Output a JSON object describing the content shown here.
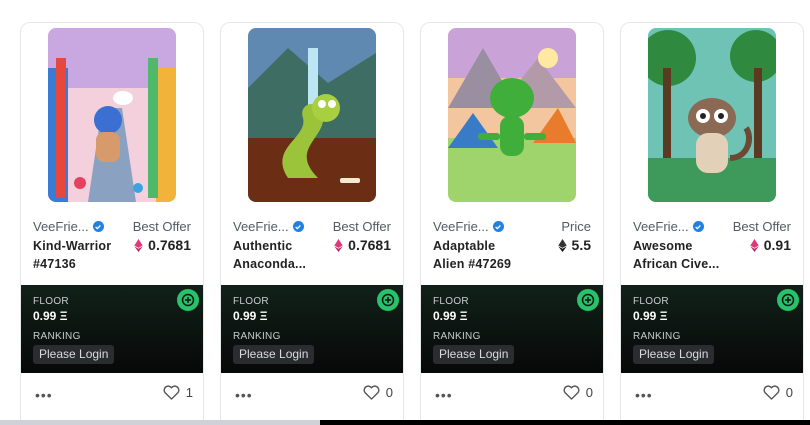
{
  "cards": [
    {
      "collection": "VeeFrie...",
      "offer_label": "Best Offer",
      "name": "Kind-Warrior #47136",
      "price": "0.7681",
      "price_icon": "eth-pink-icon",
      "floor_label": "FLOOR",
      "floor_value": "0.99 Ξ",
      "ranking_label": "RANKING",
      "login_label": "Please Login",
      "more_label": "•••",
      "likes": "1",
      "art_colors": {
        "sky": "#f7c5d1",
        "ground": "#7a8fb0"
      }
    },
    {
      "collection": "VeeFrie...",
      "offer_label": "Best Offer",
      "name": "Authentic Anaconda...",
      "price": "0.7681",
      "price_icon": "eth-pink-icon",
      "floor_label": "FLOOR",
      "floor_value": "0.99 Ξ",
      "ranking_label": "RANKING",
      "login_label": "Please Login",
      "more_label": "•••",
      "likes": "0",
      "art_colors": {
        "sky": "#5f89b0",
        "ground": "#6b2e15"
      }
    },
    {
      "collection": "VeeFrie...",
      "offer_label": "Price",
      "name": "Adaptable Alien #47269",
      "price": "5.5",
      "price_icon": "eth-dark-icon",
      "floor_label": "FLOOR",
      "floor_value": "0.99 Ξ",
      "ranking_label": "RANKING",
      "login_label": "Please Login",
      "more_label": "•••",
      "likes": "0",
      "art_colors": {
        "sky": "#f3c6a0",
        "ground": "#9fd36b"
      }
    },
    {
      "collection": "VeeFrie...",
      "offer_label": "Best Offer",
      "name": "Awesome African Cive...",
      "price": "0.91",
      "price_icon": "eth-pink-icon",
      "floor_label": "FLOOR",
      "floor_value": "0.99 Ξ",
      "ranking_label": "RANKING",
      "login_label": "Please Login",
      "more_label": "•••",
      "likes": "0",
      "art_colors": {
        "sky": "#6fc3b5",
        "ground": "#3d9a5a"
      }
    }
  ],
  "colors": {
    "verified_blue": "#2081e2",
    "eth_pink": "#e2367a",
    "stats_bg": "#0b1410",
    "market_green": "#27c26b"
  }
}
